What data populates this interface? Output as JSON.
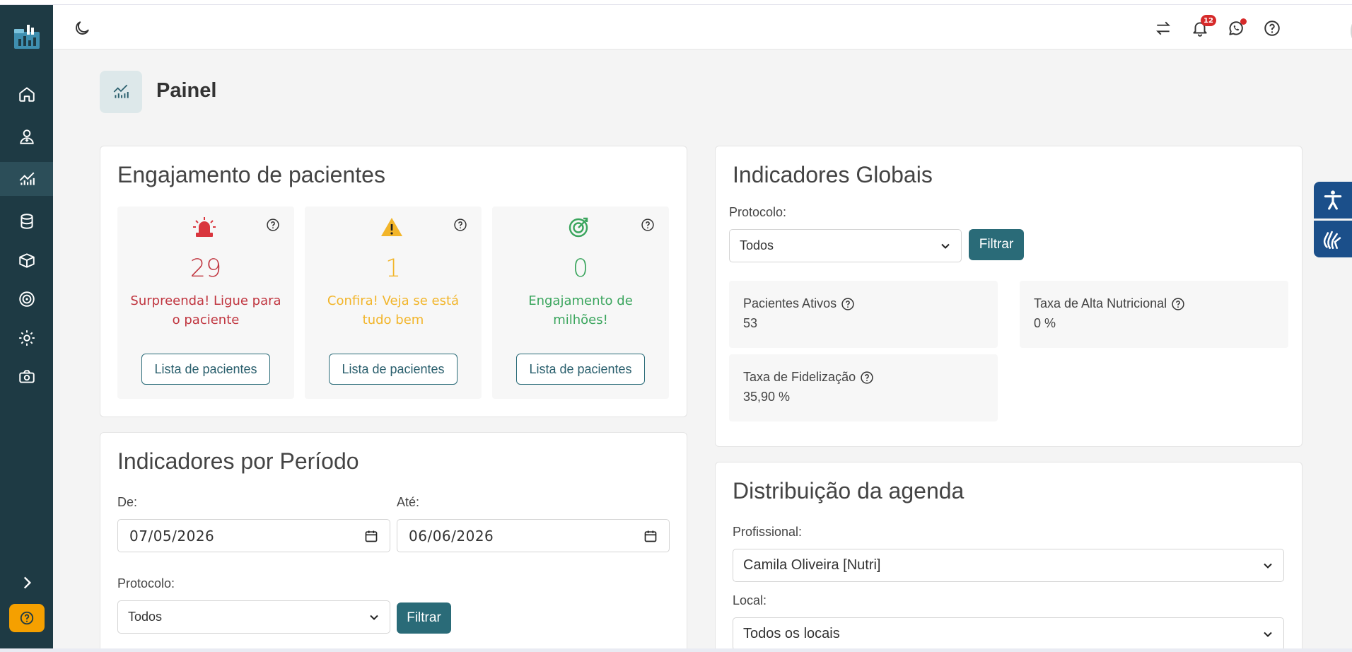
{
  "colors": {
    "sidebar": "#1e3a44",
    "primary": "#2a6b78",
    "red": "#c0353f",
    "yellow": "#f2b52a",
    "green": "#3aa55d",
    "help_button": "#f5a000",
    "accessibility": "#1b4f8a"
  },
  "sidebar": {
    "items": [
      {
        "icon": "home-icon"
      },
      {
        "icon": "patient-icon"
      },
      {
        "icon": "dashboard-icon"
      },
      {
        "icon": "database-icon"
      },
      {
        "icon": "package-icon"
      },
      {
        "icon": "target-icon"
      },
      {
        "icon": "gear-icon"
      },
      {
        "icon": "camera-icon"
      }
    ],
    "active_index": 2,
    "expand_icon": "chevron-right-icon",
    "help_icon": "question-icon"
  },
  "topbar": {
    "theme_icon": "moon-icon",
    "notifications_count": "12",
    "icons": [
      "transfer-icon",
      "bell-icon",
      "whatsapp-icon",
      "help-icon"
    ]
  },
  "page": {
    "title": "Painel",
    "icon": "dashboard-icon"
  },
  "engagement": {
    "title": "Engajamento de pacientes",
    "boxes": [
      {
        "count": "29",
        "message": "Surpreenda! Ligue para o paciente",
        "button": "Lista de pacientes",
        "icon": "siren-icon",
        "color": "#c0353f"
      },
      {
        "count": "1",
        "message": "Confira! Veja se está tudo bem",
        "button": "Lista de pacientes",
        "icon": "warning-icon",
        "color": "#f2b52a"
      },
      {
        "count": "0",
        "message": "Engajamento de milhões!",
        "button": "Lista de pacientes",
        "icon": "target-check-icon",
        "color": "#3aa55d"
      }
    ]
  },
  "global_indicators": {
    "title": "Indicadores Globais",
    "protocol_label": "Protocolo:",
    "protocol_value": "Todos",
    "filter_button": "Filtrar",
    "stats": [
      {
        "label": "Pacientes Ativos",
        "value": "53"
      },
      {
        "label": "Taxa de Alta Nutricional",
        "value": "0 %"
      },
      {
        "label": "Taxa de Fidelização",
        "value": "35,90 %"
      }
    ]
  },
  "period_indicators": {
    "title": "Indicadores por Período",
    "from_label": "De:",
    "from_value": "07/05/2026",
    "to_label": "Até:",
    "to_value": "06/06/2026",
    "protocol_label": "Protocolo:",
    "protocol_value": "Todos",
    "filter_button": "Filtrar"
  },
  "schedule": {
    "title": "Distribuição da agenda",
    "professional_label": "Profissional:",
    "professional_value": "Camila Oliveira [Nutri]",
    "location_label": "Local:",
    "location_value": "Todos os locais"
  }
}
